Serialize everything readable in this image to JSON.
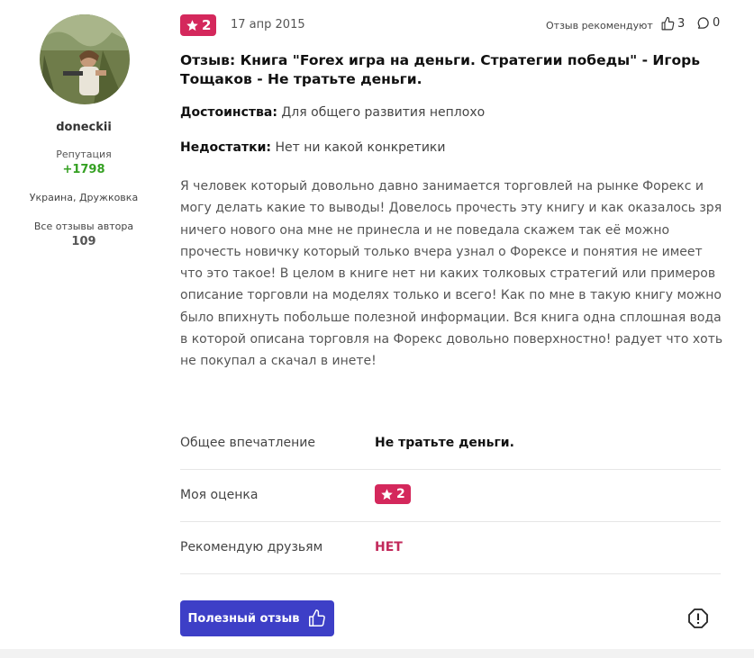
{
  "author": {
    "name": "doneckii",
    "reputation_label": "Репутация",
    "reputation_value": "+1798",
    "location": "Украина, Дружковка",
    "all_reviews_label": "Все отзывы автора",
    "all_reviews_count": "109"
  },
  "review": {
    "rating": "2",
    "date": "17 апр 2015",
    "recommend_label": "Отзыв рекомендуют",
    "likes": "3",
    "comments": "0",
    "title": "Отзыв: Книга \"Forex игра на деньги. Стратегии победы\" - Игорь Тощаков - Не тратьте деньги.",
    "pros_label": "Достоинства:",
    "pros": " Для общего развития неплохо",
    "cons_label": "Недостатки:",
    "cons": " Нет ни какой конкретики",
    "body": "Я человек который довольно давно занимается торговлей на рынке Форекс и могу делать какие то выводы! Довелось прочесть эту книгу и как оказалось зря ничего нового она мне не принесла и не поведала скажем так её можно прочесть новичку который только вчера узнал о Форексе и понятия не имеет что это такое! В целом в книге нет ни каких толковых стратегий или примеров описание торговли на моделях только и всего! Как по мне в такую книгу можно было впихнуть побольше полезной информации. Вся книга одна сплошная вода в которой описана торговля на Форекс довольно поверхностно! радует что хоть не покупал а скачал в инете!"
  },
  "summary": {
    "impression_label": "Общее впечатление",
    "impression_value": "Не тратьте деньги.",
    "rating_label": "Моя оценка",
    "rating_value": "2",
    "recommend_label": "Рекомендую друзьям",
    "recommend_value": "НЕТ"
  },
  "actions": {
    "useful_label": "Полезный отзыв"
  },
  "colors": {
    "badge": "#d4285c",
    "button": "#3d3fc7",
    "reputation": "#34a022"
  }
}
